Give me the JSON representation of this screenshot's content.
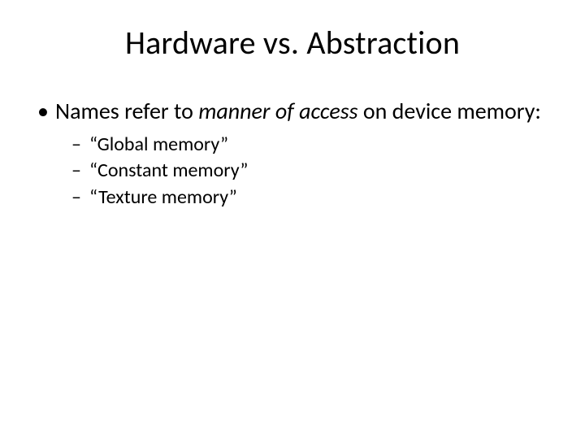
{
  "title": "Hardware vs. Abstraction",
  "bullet_l1": {
    "prefix": "Names refer to ",
    "italic": "manner of access",
    "suffix": " on device memory:"
  },
  "sub_bullets": [
    "“Global memory”",
    "“Constant memory”",
    "“Texture memory”"
  ]
}
